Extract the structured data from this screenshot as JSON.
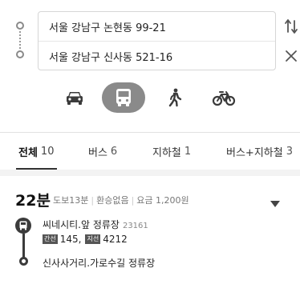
{
  "route": {
    "origin": "서울 강남구 논현동 99-21",
    "destination": "서울 강남구 신사동 521-16"
  },
  "icons": {
    "swap": "swap-vertical-icon",
    "close": "close-icon",
    "modes": [
      "car-icon",
      "bus-icon",
      "walk-icon",
      "bicycle-icon"
    ]
  },
  "active_mode": "bus",
  "tabs": [
    {
      "label": "전체",
      "count": "10",
      "active": true
    },
    {
      "label": "버스",
      "count": "6"
    },
    {
      "label": "지하철",
      "count": "1"
    },
    {
      "label": "버스+지하철",
      "count": "3"
    }
  ],
  "result": {
    "time": "22분",
    "walk": "도보13분",
    "transfer": "환승없음",
    "fare": "요금 1,200원",
    "board_stop": "씨네시티.앞 정류장",
    "board_stop_id": "23161",
    "lines": [
      {
        "type": "간선",
        "number": "145"
      },
      {
        "type": "지선",
        "number": "4212"
      }
    ],
    "alight_stop": "신사사거리.가로수길 정류장"
  },
  "colors": {
    "active_mode_bg": "#8a8a8a",
    "route_dark": "#3b3b3b",
    "band": "#f3f3f3"
  }
}
